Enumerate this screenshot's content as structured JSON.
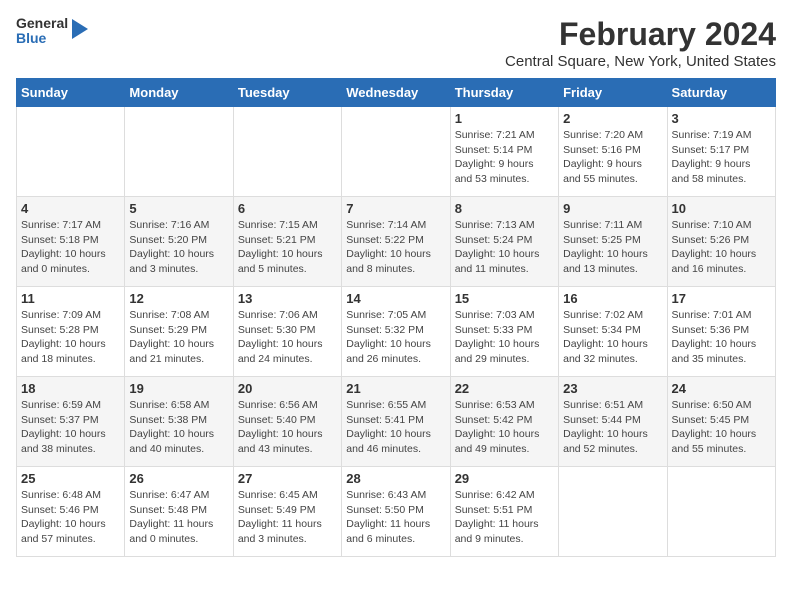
{
  "logo": {
    "general": "General",
    "blue": "Blue"
  },
  "title": "February 2024",
  "subtitle": "Central Square, New York, United States",
  "days_of_week": [
    "Sunday",
    "Monday",
    "Tuesday",
    "Wednesday",
    "Thursday",
    "Friday",
    "Saturday"
  ],
  "weeks": [
    [
      {
        "day": "",
        "info": ""
      },
      {
        "day": "",
        "info": ""
      },
      {
        "day": "",
        "info": ""
      },
      {
        "day": "",
        "info": ""
      },
      {
        "day": "1",
        "info": "Sunrise: 7:21 AM\nSunset: 5:14 PM\nDaylight: 9 hours\nand 53 minutes."
      },
      {
        "day": "2",
        "info": "Sunrise: 7:20 AM\nSunset: 5:16 PM\nDaylight: 9 hours\nand 55 minutes."
      },
      {
        "day": "3",
        "info": "Sunrise: 7:19 AM\nSunset: 5:17 PM\nDaylight: 9 hours\nand 58 minutes."
      }
    ],
    [
      {
        "day": "4",
        "info": "Sunrise: 7:17 AM\nSunset: 5:18 PM\nDaylight: 10 hours\nand 0 minutes."
      },
      {
        "day": "5",
        "info": "Sunrise: 7:16 AM\nSunset: 5:20 PM\nDaylight: 10 hours\nand 3 minutes."
      },
      {
        "day": "6",
        "info": "Sunrise: 7:15 AM\nSunset: 5:21 PM\nDaylight: 10 hours\nand 5 minutes."
      },
      {
        "day": "7",
        "info": "Sunrise: 7:14 AM\nSunset: 5:22 PM\nDaylight: 10 hours\nand 8 minutes."
      },
      {
        "day": "8",
        "info": "Sunrise: 7:13 AM\nSunset: 5:24 PM\nDaylight: 10 hours\nand 11 minutes."
      },
      {
        "day": "9",
        "info": "Sunrise: 7:11 AM\nSunset: 5:25 PM\nDaylight: 10 hours\nand 13 minutes."
      },
      {
        "day": "10",
        "info": "Sunrise: 7:10 AM\nSunset: 5:26 PM\nDaylight: 10 hours\nand 16 minutes."
      }
    ],
    [
      {
        "day": "11",
        "info": "Sunrise: 7:09 AM\nSunset: 5:28 PM\nDaylight: 10 hours\nand 18 minutes."
      },
      {
        "day": "12",
        "info": "Sunrise: 7:08 AM\nSunset: 5:29 PM\nDaylight: 10 hours\nand 21 minutes."
      },
      {
        "day": "13",
        "info": "Sunrise: 7:06 AM\nSunset: 5:30 PM\nDaylight: 10 hours\nand 24 minutes."
      },
      {
        "day": "14",
        "info": "Sunrise: 7:05 AM\nSunset: 5:32 PM\nDaylight: 10 hours\nand 26 minutes."
      },
      {
        "day": "15",
        "info": "Sunrise: 7:03 AM\nSunset: 5:33 PM\nDaylight: 10 hours\nand 29 minutes."
      },
      {
        "day": "16",
        "info": "Sunrise: 7:02 AM\nSunset: 5:34 PM\nDaylight: 10 hours\nand 32 minutes."
      },
      {
        "day": "17",
        "info": "Sunrise: 7:01 AM\nSunset: 5:36 PM\nDaylight: 10 hours\nand 35 minutes."
      }
    ],
    [
      {
        "day": "18",
        "info": "Sunrise: 6:59 AM\nSunset: 5:37 PM\nDaylight: 10 hours\nand 38 minutes."
      },
      {
        "day": "19",
        "info": "Sunrise: 6:58 AM\nSunset: 5:38 PM\nDaylight: 10 hours\nand 40 minutes."
      },
      {
        "day": "20",
        "info": "Sunrise: 6:56 AM\nSunset: 5:40 PM\nDaylight: 10 hours\nand 43 minutes."
      },
      {
        "day": "21",
        "info": "Sunrise: 6:55 AM\nSunset: 5:41 PM\nDaylight: 10 hours\nand 46 minutes."
      },
      {
        "day": "22",
        "info": "Sunrise: 6:53 AM\nSunset: 5:42 PM\nDaylight: 10 hours\nand 49 minutes."
      },
      {
        "day": "23",
        "info": "Sunrise: 6:51 AM\nSunset: 5:44 PM\nDaylight: 10 hours\nand 52 minutes."
      },
      {
        "day": "24",
        "info": "Sunrise: 6:50 AM\nSunset: 5:45 PM\nDaylight: 10 hours\nand 55 minutes."
      }
    ],
    [
      {
        "day": "25",
        "info": "Sunrise: 6:48 AM\nSunset: 5:46 PM\nDaylight: 10 hours\nand 57 minutes."
      },
      {
        "day": "26",
        "info": "Sunrise: 6:47 AM\nSunset: 5:48 PM\nDaylight: 11 hours\nand 0 minutes."
      },
      {
        "day": "27",
        "info": "Sunrise: 6:45 AM\nSunset: 5:49 PM\nDaylight: 11 hours\nand 3 minutes."
      },
      {
        "day": "28",
        "info": "Sunrise: 6:43 AM\nSunset: 5:50 PM\nDaylight: 11 hours\nand 6 minutes."
      },
      {
        "day": "29",
        "info": "Sunrise: 6:42 AM\nSunset: 5:51 PM\nDaylight: 11 hours\nand 9 minutes."
      },
      {
        "day": "",
        "info": ""
      },
      {
        "day": "",
        "info": ""
      }
    ]
  ]
}
